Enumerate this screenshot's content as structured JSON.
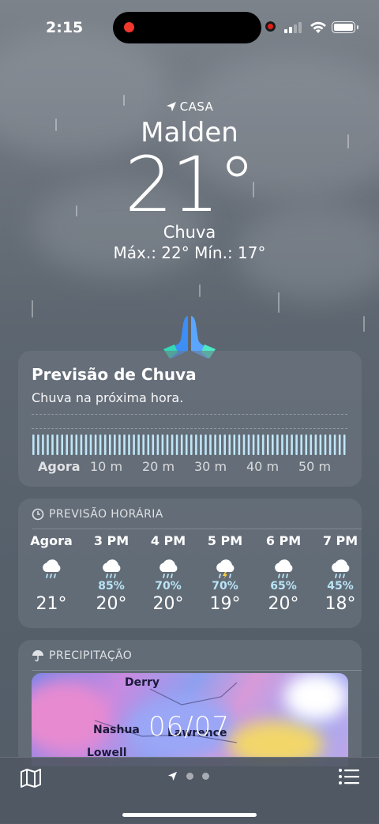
{
  "status": {
    "time": "2:15"
  },
  "hero": {
    "location_label": "CASA",
    "city": "Malden",
    "temperature": "21°",
    "condition": "Chuva",
    "high_low": "Máx.: 22°  Mín.: 17°"
  },
  "rain_card": {
    "title": "Previsão de Chuva",
    "subtitle": "Chuva na próxima hora.",
    "ticks": [
      "Agora",
      "10 m",
      "20 m",
      "30 m",
      "40 m",
      "50 m"
    ]
  },
  "hourly_card": {
    "header": "PREVISÃO HORÁRIA",
    "hours": [
      {
        "label": "Agora",
        "pct": "",
        "temp": "21°",
        "icon": "cloud-rain-icon"
      },
      {
        "label": "3 PM",
        "pct": "85%",
        "temp": "20°",
        "icon": "cloud-rain-icon"
      },
      {
        "label": "4 PM",
        "pct": "70%",
        "temp": "20°",
        "icon": "cloud-rain-icon"
      },
      {
        "label": "5 PM",
        "pct": "70%",
        "temp": "19°",
        "icon": "cloud-bolt-rain-icon"
      },
      {
        "label": "6 PM",
        "pct": "65%",
        "temp": "20°",
        "icon": "cloud-rain-icon"
      },
      {
        "label": "7 PM",
        "pct": "45%",
        "temp": "18°",
        "icon": "cloud-rain-icon"
      }
    ]
  },
  "precip_card": {
    "header": "PRECIPITAÇÃO",
    "map_labels": [
      "Derry",
      "Nashua",
      "Lawrence",
      "Lowell"
    ],
    "date": "06/07"
  },
  "tabbar": {
    "page_count": 2,
    "current": 0
  }
}
